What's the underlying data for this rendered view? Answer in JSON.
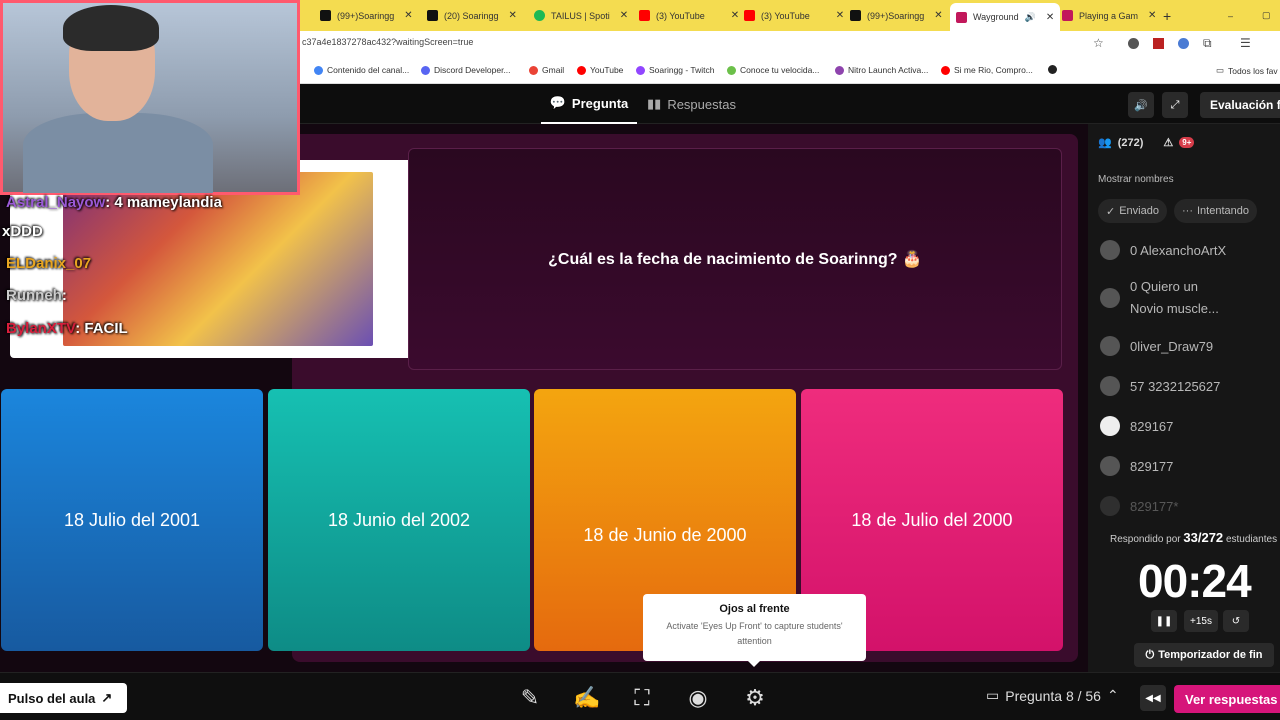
{
  "browser": {
    "tabs": [
      {
        "title": "(99+)Soaringg",
        "icon_color": "#111111"
      },
      {
        "title": "(20) Soaringg",
        "icon_color": "#111111"
      },
      {
        "title": "TAILUS | Spoti",
        "icon_color": "#1db954"
      },
      {
        "title": "(3) YouTube",
        "icon_color": "#ff0000"
      },
      {
        "title": "(3) YouTube",
        "icon_color": "#ff0000"
      },
      {
        "title": "(99+)Soaringg",
        "icon_color": "#111111"
      },
      {
        "title": "Wayground",
        "icon_color": "#c2185b"
      },
      {
        "title": "Playing a Gam",
        "icon_color": "#c2185b"
      }
    ],
    "url": "c37a4e1837278ac432?waitingScreen=true",
    "bookmarks": [
      "Contenido del canal...",
      "Discord Developer...",
      "Gmail",
      "YouTube",
      "Soaringg - Twitch",
      "Conoce tu velocida...",
      "Nitro Launch Activa...",
      "Si me Rio, Compro...",
      "Todos los fav"
    ]
  },
  "topbar": {
    "tab_question": "Pregunta",
    "tab_answers": "Respuestas",
    "eval_button": "Evaluación fin"
  },
  "question": {
    "text": "¿Cuál es la fecha de nacimiento de Soarinng? 🎂"
  },
  "options": [
    {
      "label": "18 Julio del 2001",
      "color": "#1a6fc4"
    },
    {
      "label": "18 Junio del 2002",
      "color": "#11a8a0"
    },
    {
      "label": "18 de Junio de 2000",
      "color": "#ee8a12"
    },
    {
      "label": "18 de Julio del 2000",
      "color": "#e0186f"
    }
  ],
  "sidebar": {
    "players_count": "(272)",
    "warn_badge": "9+",
    "show_names": "Mostrar nombres",
    "filter_sent": "Enviado",
    "filter_trying": "Intentando",
    "players": [
      "0 AlexanchoArtX",
      "0 Quiero un",
      "Novio muscle...",
      "0liver_Draw79",
      "57 3232125627",
      "829167",
      "829177",
      "829177*"
    ],
    "answered_prefix": "Respondido por",
    "answered_count": "33/272",
    "answered_suffix": "estudiantes",
    "timer": "00:24",
    "add_time": "+15s",
    "end_timer": "Temporizador de fin"
  },
  "tooltip": {
    "title": "Ojos al frente",
    "body": "Activate 'Eyes Up Front' to capture students' attention"
  },
  "bottombar": {
    "pulse": "Pulso del aula",
    "question_nav": "Pregunta 8 / 56",
    "see_answers": "Ver respuestas"
  },
  "chat": [
    {
      "user": "Astral_Nayow",
      "msg": ": 4 mameylandia",
      "color": "#9b59d6"
    },
    {
      "user": "xDDD",
      "msg": "",
      "color": "#ffffff"
    },
    {
      "user": "ELDanix_07",
      "msg": "",
      "color": "#e8a520"
    },
    {
      "user": "Runneh",
      "msg": ":",
      "color": "#cccccc"
    },
    {
      "user": "BylanXTV",
      "msg": ": FACIL",
      "color": "#d81e3c"
    }
  ]
}
